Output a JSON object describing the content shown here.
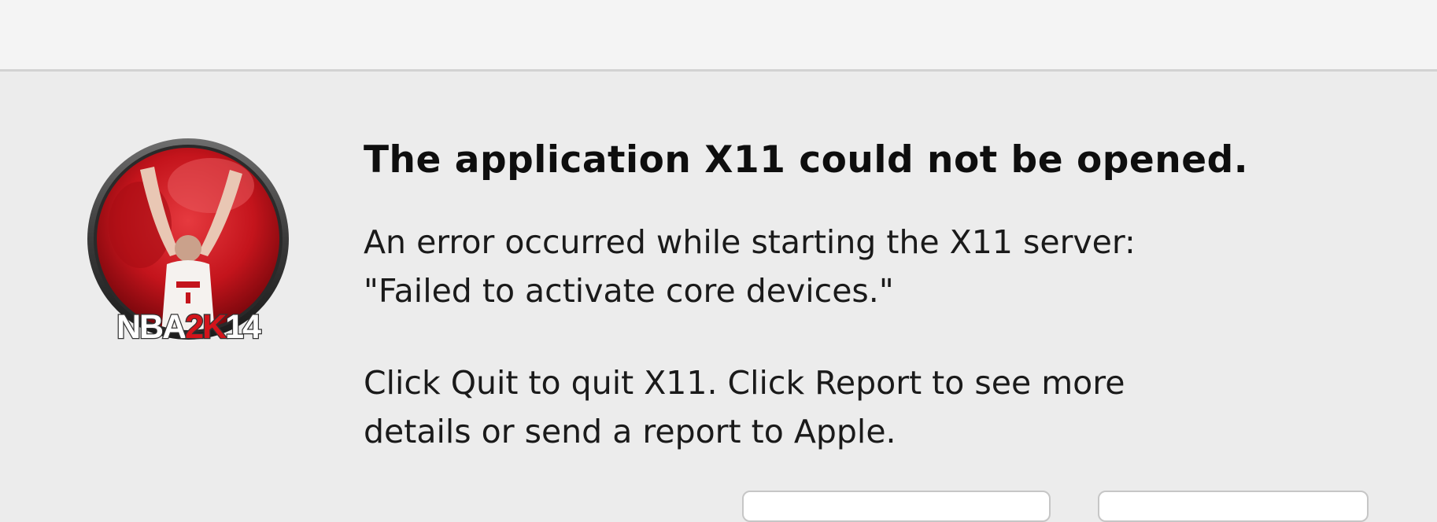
{
  "dialog": {
    "title": "The application X11 could not be opened.",
    "message_lines": [
      "An error occurred while starting the X11 server:",
      "\"Failed to activate core devices.\"",
      "Click Quit to quit X11. Click Report to see more",
      "details or send a report to Apple."
    ],
    "icon": {
      "name": "nba-2k14-app-icon",
      "logo_text": "NBA2K14"
    },
    "buttons": {
      "left_label": "",
      "right_label": ""
    }
  },
  "colors": {
    "dialog_background": "#ececec",
    "titlebar_background": "#f4f4f4",
    "icon_red": "#c4141c",
    "text": "#1a1a1a"
  }
}
